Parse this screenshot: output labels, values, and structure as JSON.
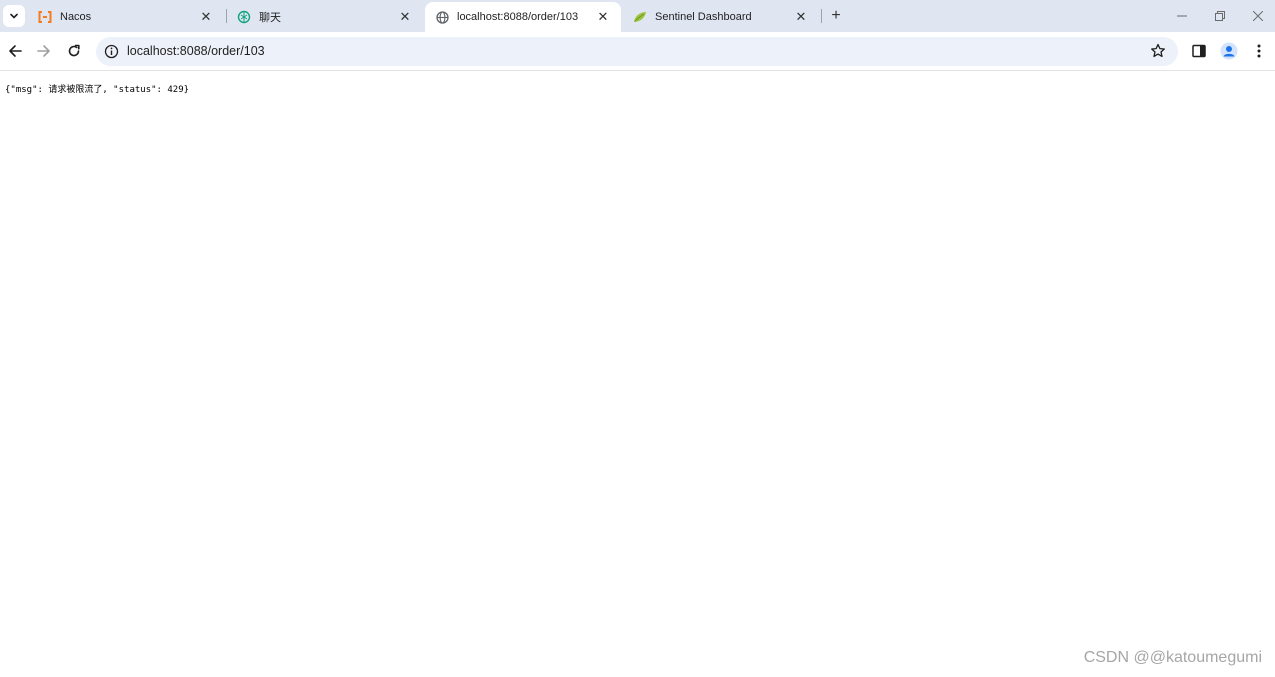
{
  "browser": {
    "tabs": [
      {
        "title": "Nacos",
        "icon": "nacos-icon",
        "active": false
      },
      {
        "title": "聊天",
        "icon": "chat-logo-icon",
        "active": false
      },
      {
        "title": "localhost:8088/order/103",
        "icon": "globe-icon",
        "active": true
      },
      {
        "title": "Sentinel Dashboard",
        "icon": "leaf-icon",
        "active": false
      }
    ],
    "close_glyph": "✕",
    "new_tab_glyph": "+",
    "url": "localhost:8088/order/103"
  },
  "page": {
    "body_text": "{\"msg\": 请求被限流了, \"status\": 429}"
  },
  "watermark": "CSDN @@katoumegumi",
  "colors": {
    "tabstrip_bg": "#dfe6f2",
    "omnibox_bg": "#edf1f9",
    "nacos_orange": "#f37b20",
    "avatar_blue": "#1a73e8",
    "leaf_green": "#9bc53d"
  }
}
